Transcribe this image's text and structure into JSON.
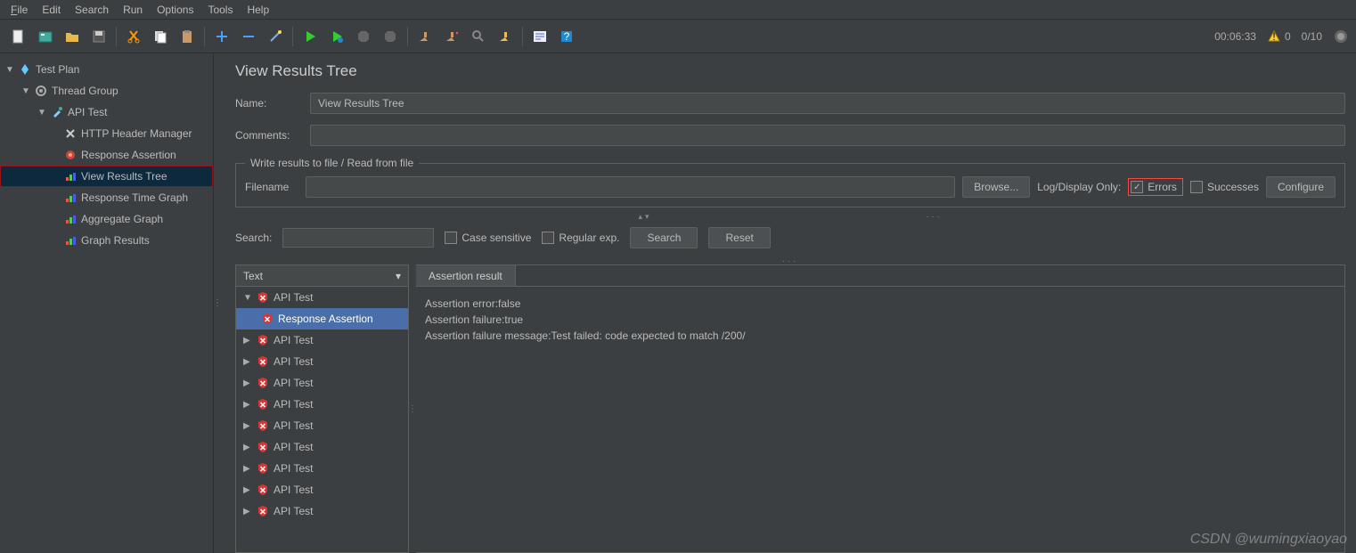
{
  "menu": [
    "File",
    "Edit",
    "Search",
    "Run",
    "Options",
    "Tools",
    "Help"
  ],
  "status": {
    "time": "00:06:33",
    "warn": "0",
    "ratio": "0/10"
  },
  "tree": {
    "root": "Test Plan",
    "group": "Thread Group",
    "sampler": "API Test",
    "items": [
      "HTTP Header Manager",
      "Response Assertion",
      "View Results Tree",
      "Response Time Graph",
      "Aggregate Graph",
      "Graph Results"
    ]
  },
  "panel": {
    "title": "View Results Tree",
    "name_label": "Name:",
    "name_value": "View Results Tree",
    "comments_label": "Comments:",
    "fieldset": "Write results to file / Read from file",
    "filename_label": "Filename",
    "browse": "Browse...",
    "logonly": "Log/Display Only:",
    "errors": "Errors",
    "successes": "Successes",
    "configure": "Configure",
    "search_label": "Search:",
    "case": "Case sensitive",
    "regex": "Regular exp.",
    "search_btn": "Search",
    "reset_btn": "Reset",
    "dropdown": "Text",
    "tab": "Assertion result",
    "line1": "Assertion error:false",
    "line2": "Assertion failure:true",
    "line3": "Assertion failure message:Test failed: code expected to match /200/",
    "sample": "API Test",
    "assertion": "Response Assertion"
  },
  "watermark": "CSDN @wumingxiaoyao"
}
